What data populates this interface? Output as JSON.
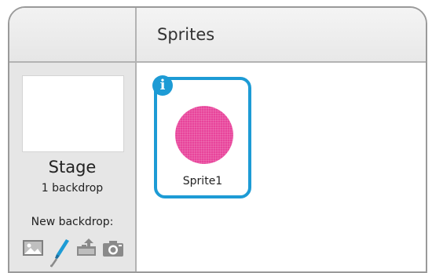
{
  "sprites_panel": {
    "title": "Sprites"
  },
  "stage": {
    "name": "Stage",
    "backdrop_count": "1 backdrop",
    "new_backdrop_label": "New backdrop:",
    "tools": [
      {
        "icon": "paint-library-icon"
      },
      {
        "icon": "paintbrush-icon"
      },
      {
        "icon": "upload-icon"
      },
      {
        "icon": "camera-icon"
      }
    ]
  },
  "sprites": [
    {
      "name": "Sprite1",
      "info_glyph": "i",
      "costume_color": "#e8449b"
    }
  ],
  "colors": {
    "accent": "#1d9bd5",
    "panel_bg": "#e6e6e6"
  }
}
